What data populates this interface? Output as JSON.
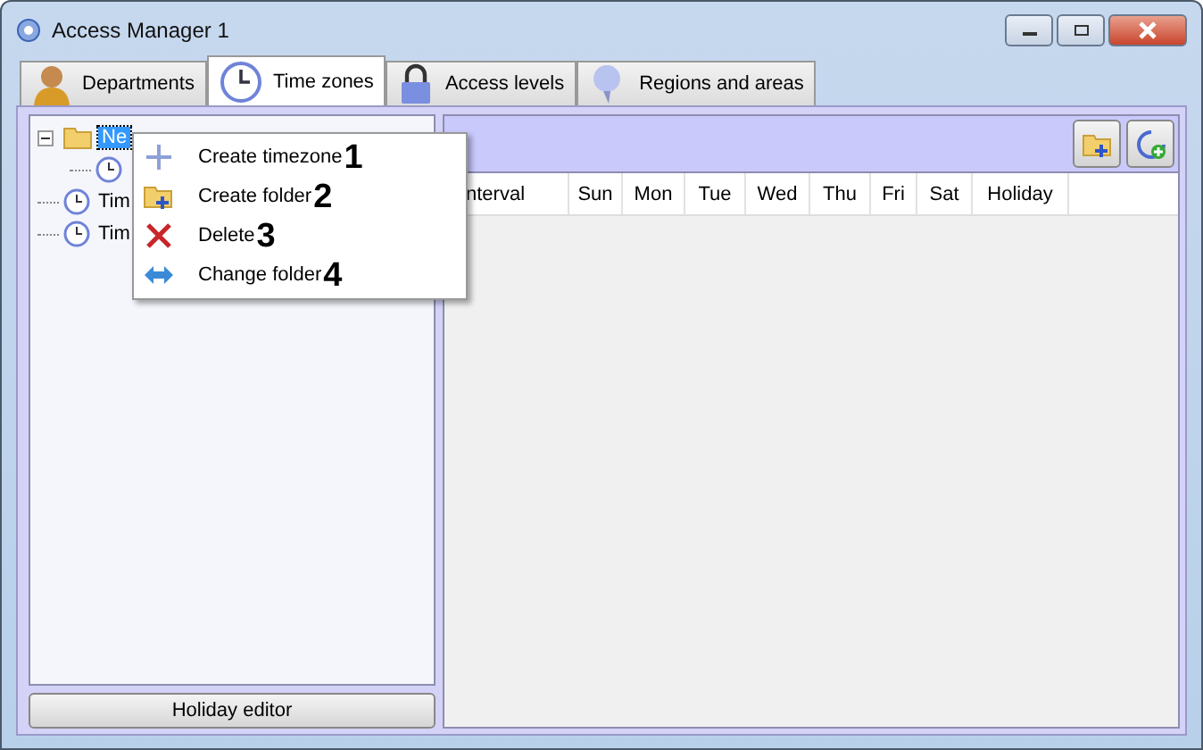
{
  "window": {
    "title": "Access Manager 1"
  },
  "tabs": [
    {
      "label": "Departments",
      "selected": false
    },
    {
      "label": "Time zones",
      "selected": true
    },
    {
      "label": "Access levels",
      "selected": false
    },
    {
      "label": "Regions and areas",
      "selected": false
    }
  ],
  "tree": [
    {
      "label": "Ne",
      "kind": "folder",
      "selected": true,
      "expanded": true,
      "children": [
        {
          "kind": "clock"
        }
      ]
    },
    {
      "label": "Tim",
      "kind": "clock",
      "selected": false
    },
    {
      "label": "Tim",
      "kind": "clock",
      "selected": false
    }
  ],
  "holiday_button": "Holiday editor",
  "table": {
    "columns": [
      "nterval",
      "Sun",
      "Mon",
      "Tue",
      "Wed",
      "Thu",
      "Fri",
      "Sat",
      "Holiday"
    ]
  },
  "context_menu": [
    {
      "label": "Create timezone",
      "number": "1"
    },
    {
      "label": "Create folder",
      "number": "2"
    },
    {
      "label": "Delete",
      "number": "3"
    },
    {
      "label": "Change folder",
      "number": "4"
    }
  ]
}
